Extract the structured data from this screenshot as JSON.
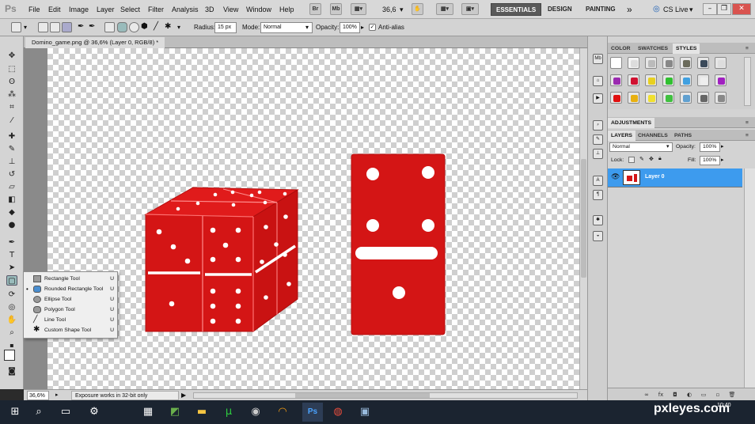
{
  "app": {
    "logo": "Ps"
  },
  "menu": [
    "File",
    "Edit",
    "Image",
    "Layer",
    "Select",
    "Filter",
    "Analysis",
    "3D",
    "View",
    "Window",
    "Help"
  ],
  "menubar_extras": {
    "zoom": "36,6",
    "chevrons": "»",
    "cs_live": "CS Live"
  },
  "workspaces": [
    "ESSENTIALS",
    "DESIGN",
    "PAINTING"
  ],
  "options": {
    "radius_label": "Radius:",
    "radius_value": "15 px",
    "mode_label": "Mode:",
    "mode_value": "Normal",
    "opacity_label": "Opacity:",
    "opacity_value": "100%",
    "antialias_label": "Anti-alias"
  },
  "document": {
    "tab_title": "Domino_game.png @ 36,6% (Layer 0, RGB/8) *"
  },
  "status": {
    "zoom": "36,6%",
    "message": "Exposure works in 32-bit only"
  },
  "flyout": [
    {
      "label": "Rectangle Tool",
      "key": "U",
      "icon": "rectangle-shape-icon",
      "checked": false
    },
    {
      "label": "Rounded Rectangle Tool",
      "key": "U",
      "icon": "rounded-rectangle-icon",
      "checked": true
    },
    {
      "label": "Ellipse Tool",
      "key": "U",
      "icon": "ellipse-icon",
      "checked": false
    },
    {
      "label": "Polygon Tool",
      "key": "U",
      "icon": "polygon-icon",
      "checked": false
    },
    {
      "label": "Line Tool",
      "key": "U",
      "icon": "line-icon",
      "checked": false
    },
    {
      "label": "Custom Shape Tool",
      "key": "U",
      "icon": "custom-shape-icon",
      "checked": false
    }
  ],
  "panels": {
    "color_tabs": [
      "COLOR",
      "SWATCHES",
      "STYLES"
    ],
    "adjustments_tab": "ADJUSTMENTS",
    "layer_tabs": [
      "LAYERS",
      "CHANNELS",
      "PATHS"
    ],
    "blend_mode": "Normal",
    "opacity_label": "Opacity:",
    "opacity_value": "100%",
    "lock_label": "Lock:",
    "fill_label": "Fill:",
    "fill_value": "100%",
    "layer_name": "Layer 0"
  },
  "taskbar": {
    "time": "10:40"
  },
  "watermark": "pxleyes.com",
  "colors": {
    "domino_red": "#d41515",
    "selection_blue": "#3d9bee",
    "taskbar": "#1b2430"
  }
}
